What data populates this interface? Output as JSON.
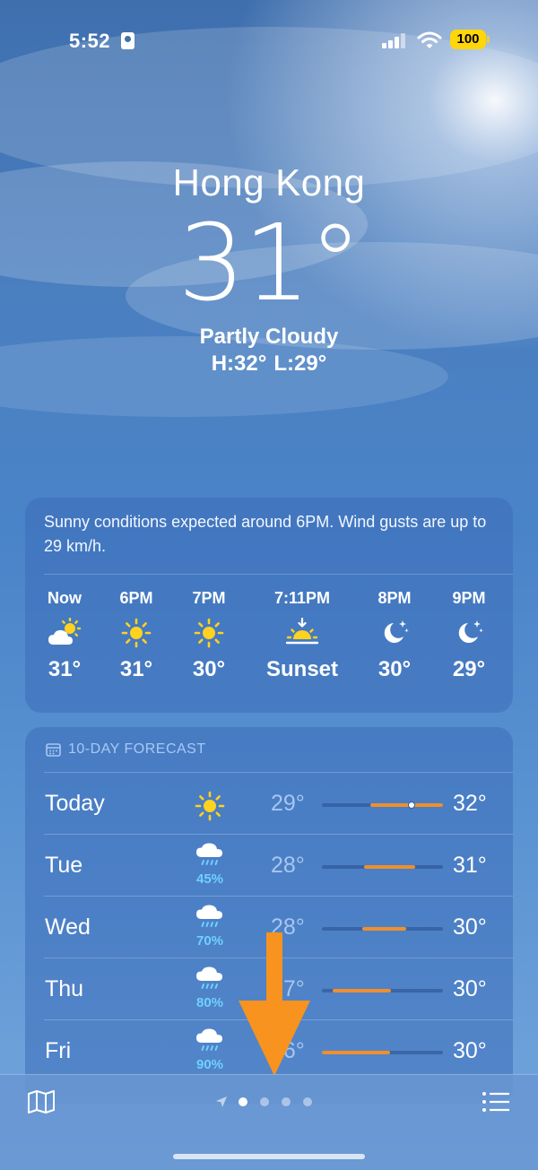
{
  "status_bar": {
    "time": "5:52",
    "battery": "100"
  },
  "hero": {
    "city": "Hong Kong",
    "temperature": "31°",
    "condition": "Partly Cloudy",
    "high": "H:32°",
    "low": "L:29°"
  },
  "hourly": {
    "summary": "Sunny conditions expected around 6PM. Wind gusts are up to 29 km/h.",
    "items": [
      {
        "label": "Now",
        "icon": "partly-sunny-icon",
        "temp": "31°"
      },
      {
        "label": "6PM",
        "icon": "sun-icon",
        "temp": "31°"
      },
      {
        "label": "7PM",
        "icon": "sun-icon",
        "temp": "30°"
      },
      {
        "label": "7:11PM",
        "icon": "sunset-icon",
        "temp": "Sunset"
      },
      {
        "label": "8PM",
        "icon": "moon-stars-icon",
        "temp": "30°"
      },
      {
        "label": "9PM",
        "icon": "moon-stars-icon",
        "temp": "29°"
      }
    ]
  },
  "forecast": {
    "heading": "10-DAY FORECAST",
    "days": [
      {
        "day": "Today",
        "icon": "sun-icon",
        "precip": "",
        "low": "29°",
        "high": "32°",
        "bar_start": 0.4,
        "bar_end": 1.0,
        "current": 0.74
      },
      {
        "day": "Tue",
        "icon": "rain-cloud-icon",
        "precip": "45%",
        "low": "28°",
        "high": "31°",
        "bar_start": 0.35,
        "bar_end": 0.77
      },
      {
        "day": "Wed",
        "icon": "rain-cloud-icon",
        "precip": "70%",
        "low": "28°",
        "high": "30°",
        "bar_start": 0.33,
        "bar_end": 0.7
      },
      {
        "day": "Thu",
        "icon": "rain-cloud-icon",
        "precip": "80%",
        "low": "27°",
        "high": "30°",
        "bar_start": 0.09,
        "bar_end": 0.57
      },
      {
        "day": "Fri",
        "icon": "rain-cloud-icon",
        "precip": "90%",
        "low": "26°",
        "high": "30°",
        "bar_start": 0.0,
        "bar_end": 0.56
      }
    ]
  },
  "pager": {
    "pages": 4,
    "active": 0
  },
  "colors": {
    "accent_orange": "#f08f2c",
    "battery_yellow": "#ffd60a",
    "precip_blue": "#6fd0ff"
  }
}
